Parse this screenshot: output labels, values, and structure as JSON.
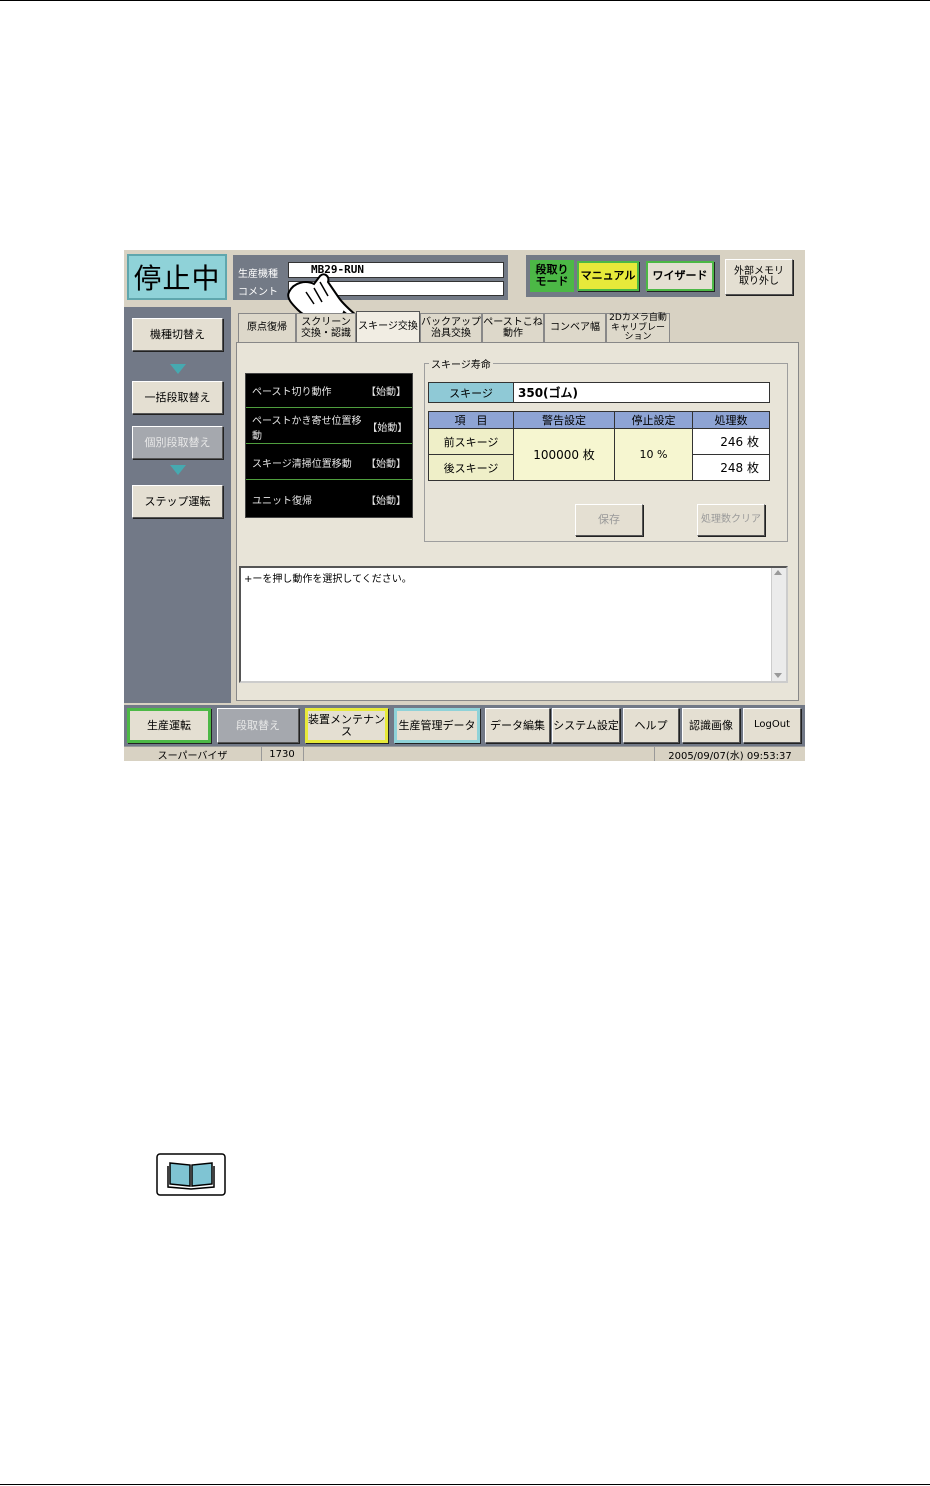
{
  "status": "停止中",
  "production": {
    "model_label": "生産機種",
    "model_value": "MB29-RUN",
    "comment_label": "コメント",
    "comment_value": ""
  },
  "mode": {
    "label": "段取り\nモード",
    "manual": "マニュアル",
    "wizard": "ワイザード"
  },
  "external_memory": "外部メモリ\n取り外し",
  "sidebar": {
    "items": [
      {
        "label": "機種切替え",
        "enabled": true
      },
      {
        "label": "一括段取替え",
        "enabled": true
      },
      {
        "label": "個別段取替え",
        "enabled": false
      },
      {
        "label": "ステップ運転",
        "enabled": true
      }
    ]
  },
  "tabs": [
    {
      "label": "原点復帰"
    },
    {
      "label": "スクリーン\n交換・認識"
    },
    {
      "label": "スキージ交換",
      "active": true
    },
    {
      "label": "バックアップ\n治具交換"
    },
    {
      "label": "ペーストこね\n動作"
    },
    {
      "label": "コンベア幅"
    },
    {
      "label": "2Dカメラ自動\nキャリブレーション"
    }
  ],
  "actions": [
    {
      "label": "ペースト切り動作",
      "key": "【始動】"
    },
    {
      "label": "ペーストかき寄せ位置移動",
      "key": "【始動】"
    },
    {
      "label": "スキージ清掃位置移動",
      "key": "【始動】"
    },
    {
      "label": "ユニット復帰",
      "key": "【始動】"
    }
  ],
  "squeegee_life": {
    "title": "スキージ寿命",
    "squeegee_label": "スキージ",
    "squeegee_value": "350(ゴム)",
    "headers": [
      "項　目",
      "警告設定",
      "停止設定",
      "処理数"
    ],
    "rows": [
      {
        "item": "前スキージ",
        "count": "246 枚"
      },
      {
        "item": "後スキージ",
        "count": "248 枚"
      }
    ],
    "warning": "100000 枚",
    "stop": "10 %",
    "save": "保存",
    "clear": "処理数クリア"
  },
  "message": "+ーを押し動作を選択してください。",
  "bottom": {
    "buttons": [
      "生産運転",
      "段取替え",
      "装置メンテナンス",
      "生産管理データ",
      "データ編集",
      "システム設定",
      "ヘルプ",
      "認識画像",
      "LogOut"
    ]
  },
  "statusbar": {
    "user": "スーパーバイザ",
    "code": "1730",
    "datetime": "2005/09/07(水) 09:53:37"
  },
  "colors": {
    "status_bg": "#8fd2d8",
    "panel_dark": "#727987",
    "manual_active": "#e7e93a",
    "mode_green": "#4cb846",
    "table_header": "#8ea4d4"
  }
}
